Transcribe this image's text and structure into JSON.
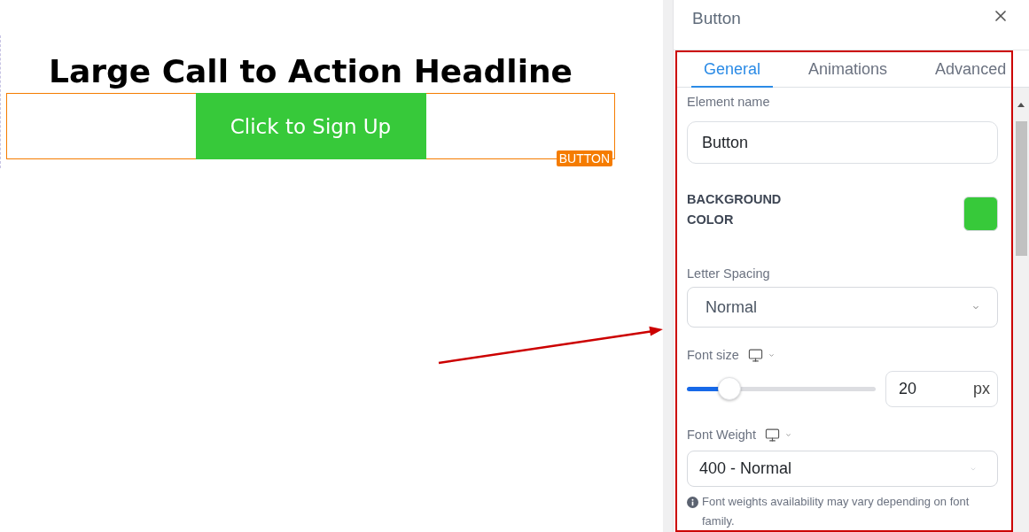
{
  "canvas": {
    "headline": "Large Call to Action Headline",
    "element": {
      "label": "Click to Sign Up",
      "selected": true,
      "badge": "BUTTON"
    }
  },
  "panel": {
    "title": "Button",
    "tabs": [
      {
        "label": "General",
        "selected": true
      },
      {
        "label": "Animations",
        "selected": false
      },
      {
        "label": "Advanced",
        "selected": false
      }
    ],
    "fields": [
      {
        "kind": "text",
        "label": "Element name",
        "value": "Button"
      },
      {
        "kind": "color",
        "label": "BACKGROUND COLOR",
        "color": "#37c93a"
      },
      {
        "kind": "select",
        "label": "Letter Spacing",
        "value": "Normal"
      },
      {
        "kind": "slider",
        "label": "Font size",
        "responsive": true,
        "level": 0.225,
        "value": "20",
        "unit": "px"
      },
      {
        "kind": "combo",
        "label": "Font Weight",
        "responsive": true,
        "value": "400 - Normal",
        "note": "Font weights availability may vary depending on font family."
      }
    ]
  }
}
